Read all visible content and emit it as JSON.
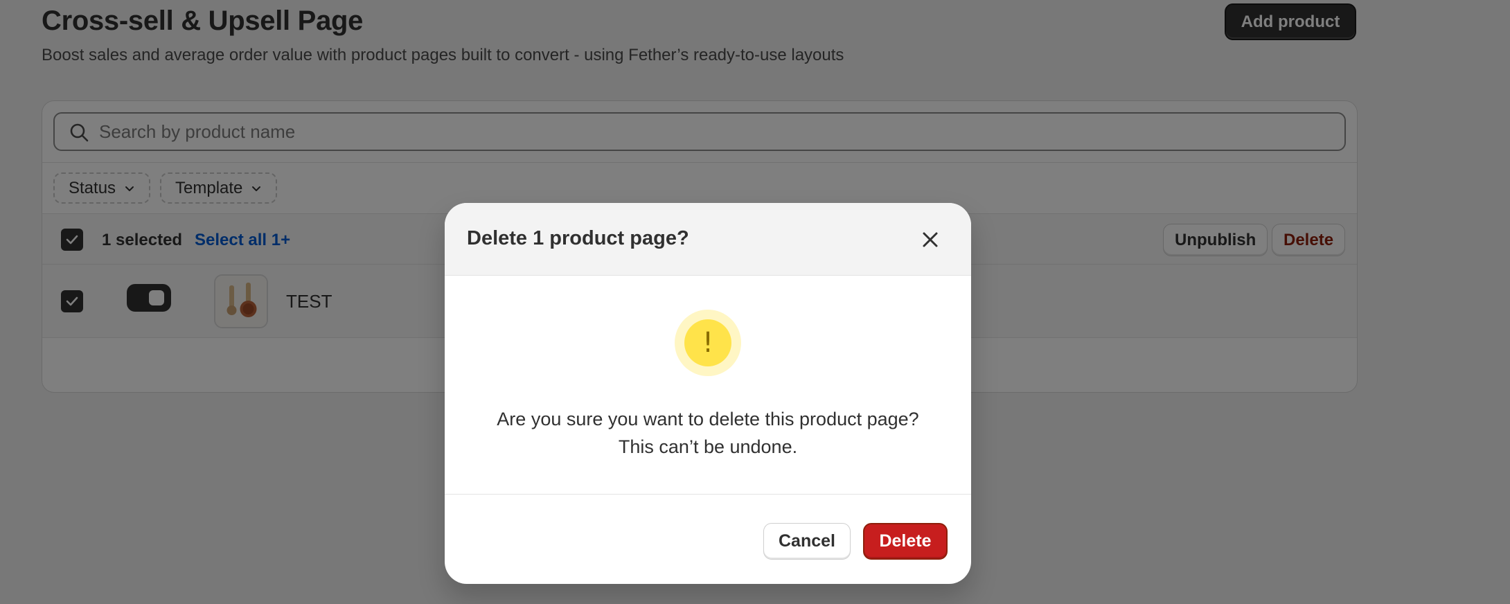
{
  "page": {
    "title": "Cross-sell & Upsell Page",
    "subtitle": "Boost sales and average order value with product pages built to convert - using Fether’s ready-to-use layouts",
    "add_product_label": "Add product"
  },
  "search": {
    "placeholder": "Search by product name",
    "value": ""
  },
  "filters": {
    "status_label": "Status",
    "template_label": "Template"
  },
  "bulk": {
    "selected_text": "1 selected",
    "select_all_label": "Select all 1+",
    "unpublish_label": "Unpublish",
    "delete_label": "Delete"
  },
  "products": [
    {
      "name": "TEST",
      "selected": true,
      "published": true
    }
  ],
  "modal": {
    "title": "Delete 1 product page?",
    "warning_glyph": "!",
    "message_line1": "Are you sure you want to delete this product page?",
    "message_line2": "This can’t be undone.",
    "cancel_label": "Cancel",
    "confirm_label": "Delete"
  },
  "colors": {
    "primary_button": "#303030",
    "critical": "#c71e1e",
    "critical_text": "#8e1f0b",
    "link": "#005bd3",
    "warning": "#ffe34a"
  }
}
